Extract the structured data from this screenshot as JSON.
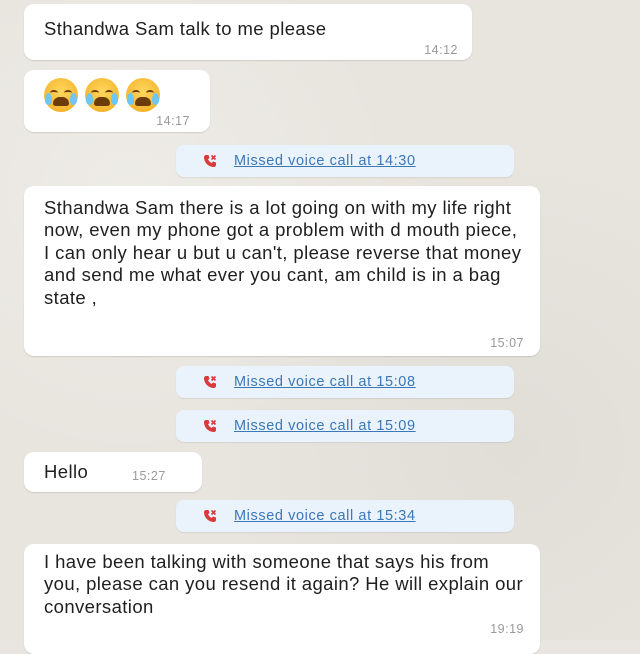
{
  "messages": [
    {
      "text": "Sthandwa Sam talk to me please",
      "time": "14:12"
    },
    {
      "emoji_icons": [
        "crying-face-icon",
        "crying-face-icon",
        "crying-face-icon"
      ],
      "time": "14:17"
    },
    {
      "text": "Sthandwa Sam there is a lot going on with my life right now, even my phone got a problem with d mouth piece, I can only hear u but u can't, please reverse that money and send me what ever you cant, am child is in a bag state ,",
      "time": "15:07"
    },
    {
      "text": "Hello",
      "time": "15:27"
    },
    {
      "text": "I have been talking with someone that says his from you, please can you resend it again? He will explain our conversation",
      "time": "19:19"
    }
  ],
  "calls": [
    {
      "label": "Missed voice call at 14:30"
    },
    {
      "label": "Missed voice call at 15:08"
    },
    {
      "label": "Missed voice call at 15:09"
    },
    {
      "label": "Missed voice call at 15:34"
    }
  ],
  "colors": {
    "missed_call": "#d93b3b",
    "link": "#3a78b8",
    "bubble": "#ffffff",
    "call_bubble": "#eaf3fb"
  }
}
